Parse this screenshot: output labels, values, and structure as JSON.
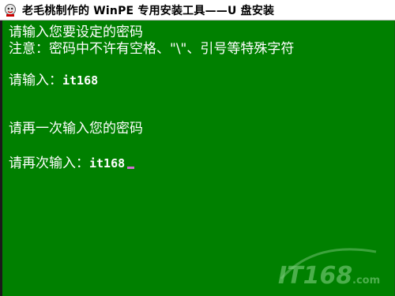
{
  "window": {
    "title": "老毛桃制作的 WinPE 专用安装工具——U 盘安装",
    "icon": "app-icon"
  },
  "console": {
    "lines": {
      "prompt_set": "请输入您要设定的密码",
      "notice": "注意：密码中不许有空格、\"\\\"、引号等特殊字符",
      "input_label": "请输入：",
      "input_value": "it168",
      "prompt_again": "请再一次输入您的密码",
      "reinput_label": "请再次输入：",
      "reinput_value": "it168"
    },
    "colors": {
      "background": "#008000",
      "text": "#ffffff",
      "cursor": "#d070d0"
    }
  },
  "watermark": {
    "text": "IT168",
    "suffix": ".com"
  }
}
